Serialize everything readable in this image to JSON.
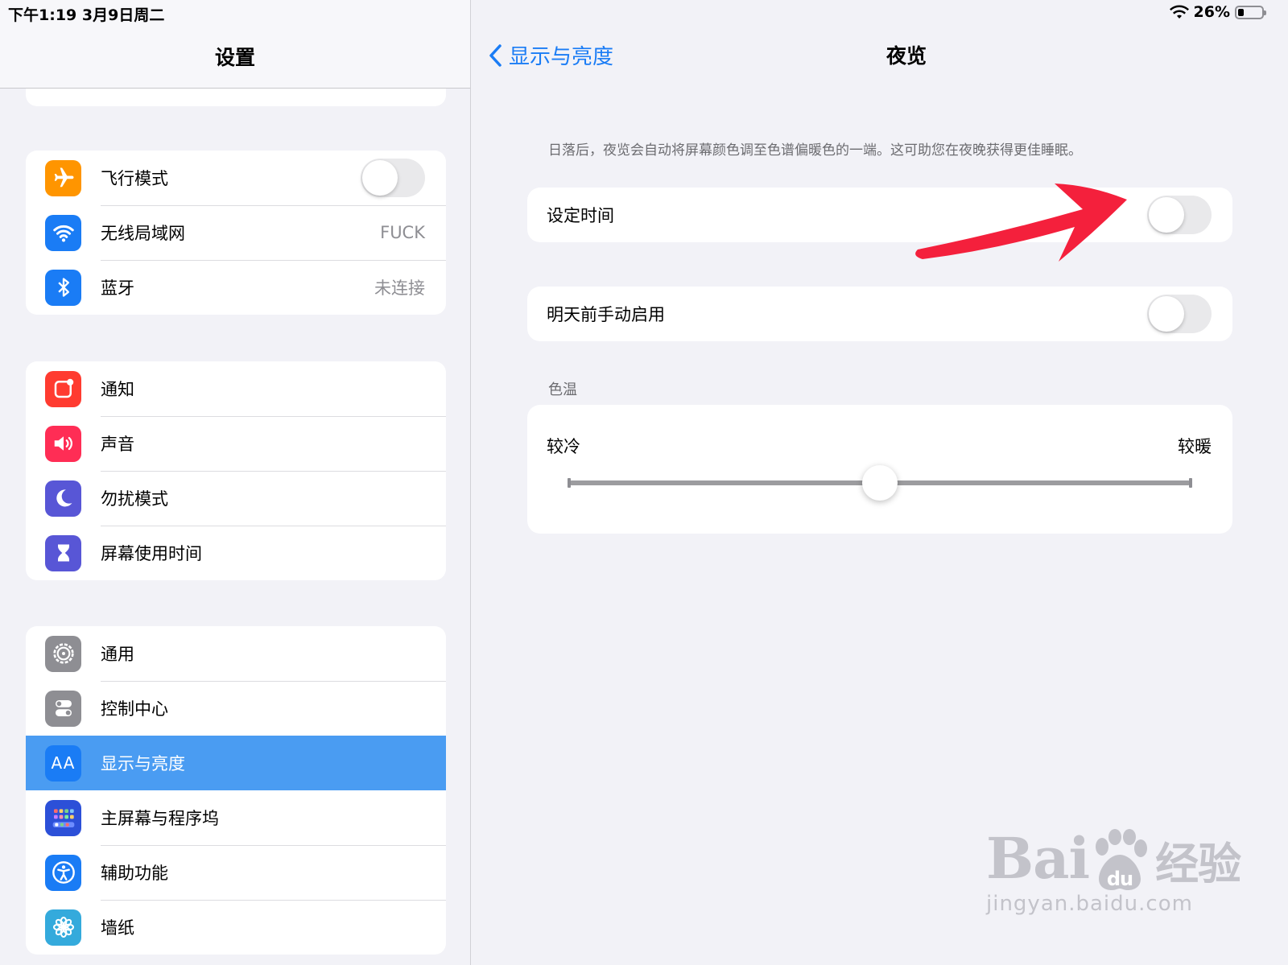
{
  "status_bar": {
    "time": "下午1:19   3月9日周二",
    "battery": "26%",
    "battery_level": 0.26
  },
  "sidebar": {
    "title": "设置",
    "groups": [
      {
        "items": [
          {
            "label": "飞行模式",
            "icon": "airplane-icon",
            "icon_color": "#ff9500",
            "control": "switch",
            "on": false
          },
          {
            "label": "无线局域网",
            "icon": "wifi-icon",
            "icon_color": "#1a7cf5",
            "value": "FUCK"
          },
          {
            "label": "蓝牙",
            "icon": "bluetooth-icon",
            "icon_color": "#1a7cf5",
            "value": "未连接"
          }
        ]
      },
      {
        "items": [
          {
            "label": "通知",
            "icon": "notifications-icon",
            "icon_color": "#ff3b30"
          },
          {
            "label": "声音",
            "icon": "speaker-icon",
            "icon_color": "#ff2d55"
          },
          {
            "label": "勿扰模式",
            "icon": "moon-icon",
            "icon_color": "#5856d6"
          },
          {
            "label": "屏幕使用时间",
            "icon": "hourglass-icon",
            "icon_color": "#5856d6"
          }
        ]
      },
      {
        "items": [
          {
            "label": "通用",
            "icon": "gear-icon",
            "icon_color": "#8e8e93"
          },
          {
            "label": "控制中心",
            "icon": "toggles-icon",
            "icon_color": "#8e8e93"
          },
          {
            "label": "显示与亮度",
            "icon": "text-size-icon",
            "icon_color": "#1a7cf5",
            "selected": true
          },
          {
            "label": "主屏幕与程序坞",
            "icon": "home-grid-icon",
            "icon_color": "#2c50d8"
          },
          {
            "label": "辅助功能",
            "icon": "accessibility-icon",
            "icon_color": "#1a7cf5"
          },
          {
            "label": "墙纸",
            "icon": "flower-icon",
            "icon_color": "#34aadc"
          }
        ]
      }
    ]
  },
  "detail": {
    "back_label": "显示与亮度",
    "title": "夜览",
    "description": "日落后，夜览会自动将屏幕颜色调至色谱偏暖色的一端。这可助您在夜晚获得更佳睡眠。",
    "scheduled": {
      "label": "设定时间",
      "on": false
    },
    "manual": {
      "label": "明天前手动启用",
      "on": false
    },
    "color_temperature": {
      "section_label": "色温",
      "min_label": "较冷",
      "max_label": "较暖",
      "value": 0.5
    }
  },
  "annotation": {
    "type": "arrow",
    "color": "#f4203c"
  },
  "watermark": {
    "brand": "Bai",
    "brand_tail": "du",
    "brand_cn": "经验",
    "url": "jingyan.baidu.com"
  }
}
